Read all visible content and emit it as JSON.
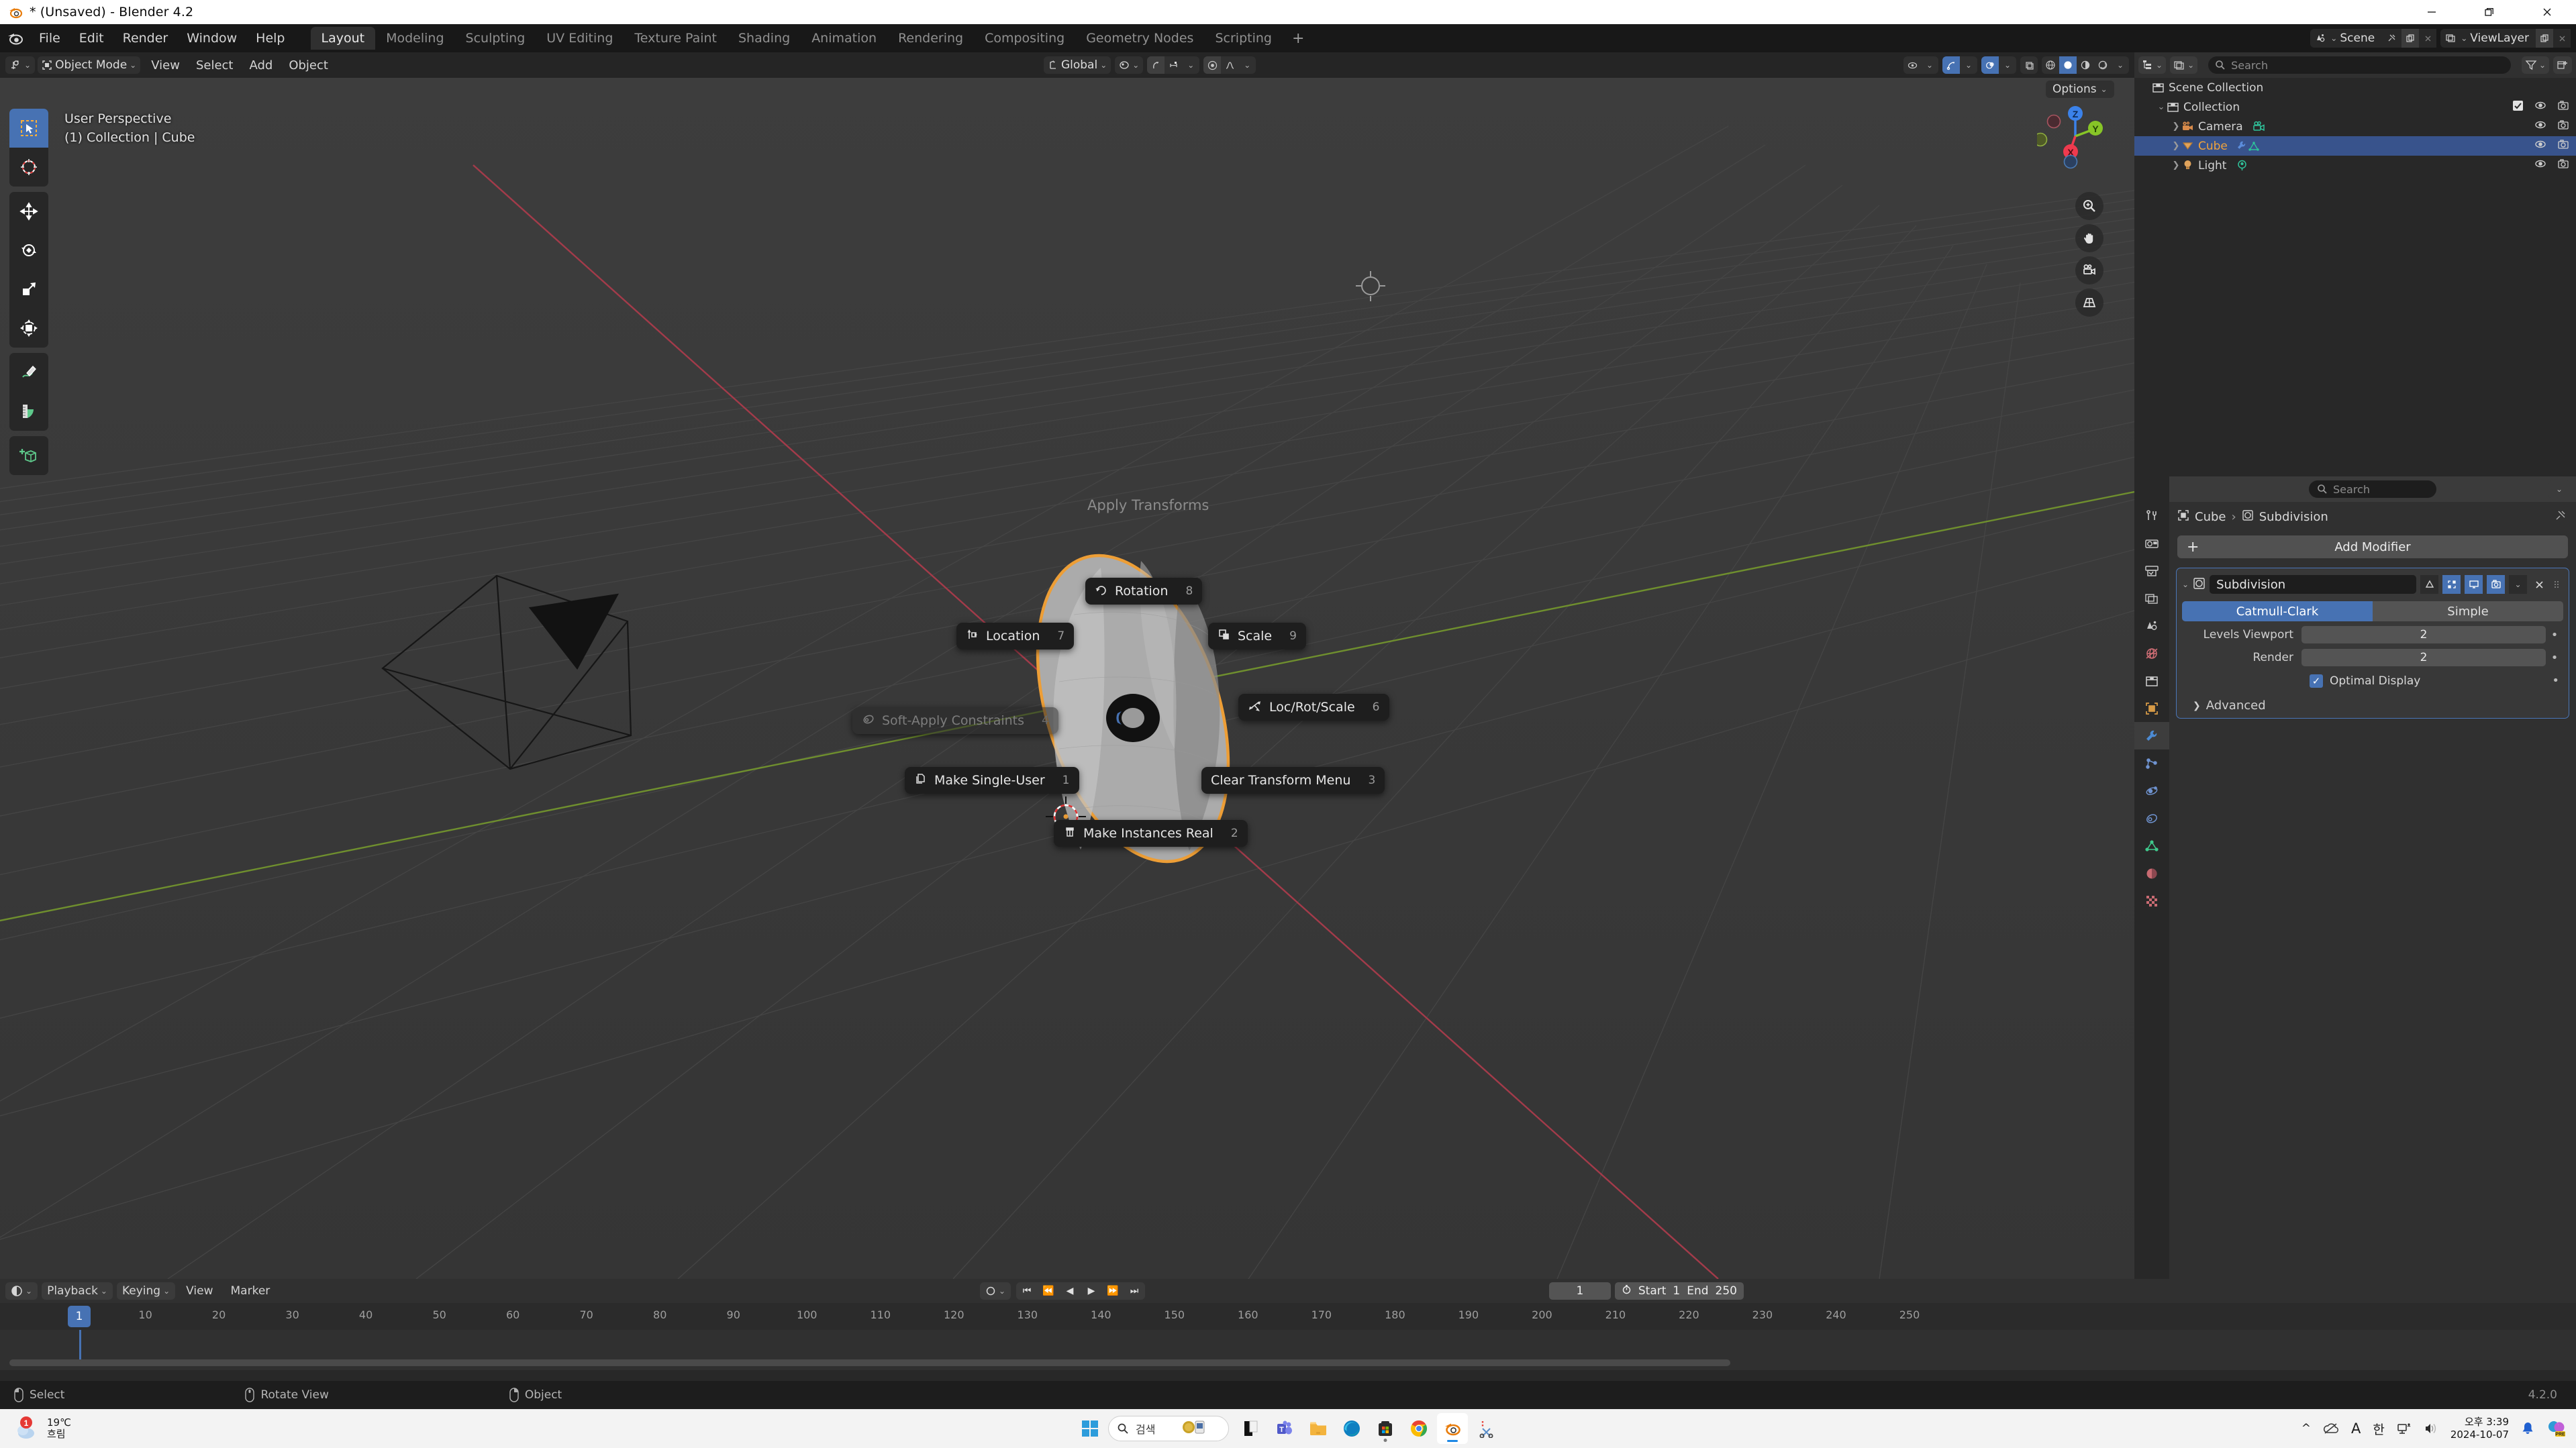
{
  "window": {
    "title": "* (Unsaved) - Blender 4.2",
    "minimize": "—",
    "restore": "❐",
    "close": "✕"
  },
  "topbar": {
    "menus": [
      "File",
      "Edit",
      "Render",
      "Window",
      "Help"
    ],
    "workspaces": [
      {
        "label": "Layout",
        "active": true
      },
      {
        "label": "Modeling",
        "active": false
      },
      {
        "label": "Sculpting",
        "active": false
      },
      {
        "label": "UV Editing",
        "active": false
      },
      {
        "label": "Texture Paint",
        "active": false
      },
      {
        "label": "Shading",
        "active": false
      },
      {
        "label": "Animation",
        "active": false
      },
      {
        "label": "Rendering",
        "active": false
      },
      {
        "label": "Compositing",
        "active": false
      },
      {
        "label": "Geometry Nodes",
        "active": false
      },
      {
        "label": "Scripting",
        "active": false
      }
    ],
    "add_workspace": "+",
    "scene_name": "Scene",
    "viewlayer_name": "ViewLayer"
  },
  "viewport_header": {
    "mode": "Object Mode",
    "menus": [
      "View",
      "Select",
      "Add",
      "Object"
    ],
    "transform_orientation": "Global",
    "options_label": "Options"
  },
  "viewport": {
    "perspective_label": "User Perspective",
    "collection_label": "(1) Collection | Cube",
    "gizmo_axes": [
      {
        "label": "Z",
        "color": "#3b82ea"
      },
      {
        "label": "Y",
        "color": "#87c527"
      },
      {
        "label": "X",
        "color": "#ef3a4e"
      }
    ],
    "tools": [
      "tweak-select-tool",
      "cursor-tool",
      "move-tool",
      "rotate-tool",
      "scale-tool",
      "transform-tool",
      "annotate-tool",
      "measure-tool",
      "add-cube-tool"
    ],
    "nav_buttons": [
      "zoom-icon",
      "pan-hand-icon",
      "camera-view-icon",
      "perspective-toggle-icon"
    ]
  },
  "pie_menu": {
    "title": "Apply Transforms",
    "items": [
      {
        "label": "Rotation",
        "shortcut": "8",
        "icon": "rotation-icon",
        "disabled": false
      },
      {
        "label": "Location",
        "shortcut": "7",
        "icon": "location-icon",
        "disabled": false
      },
      {
        "label": "Scale",
        "shortcut": "9",
        "icon": "scale-icon",
        "disabled": false
      },
      {
        "label": "Soft-Apply Constraints",
        "shortcut": "4",
        "icon": "constraints-icon",
        "disabled": true
      },
      {
        "label": "Loc/Rot/Scale",
        "shortcut": "6",
        "icon": "locrotscale-icon",
        "disabled": false
      },
      {
        "label": "Make Single-User",
        "shortcut": "1",
        "icon": "copy-icon",
        "disabled": false
      },
      {
        "label": "Clear Transform Menu",
        "shortcut": "3",
        "icon": "",
        "disabled": false
      },
      {
        "label": "Make Instances Real",
        "shortcut": "2",
        "icon": "instances-icon",
        "disabled": false
      }
    ]
  },
  "outliner": {
    "search_placeholder": "Search",
    "rows": [
      {
        "label": "Scene Collection",
        "indent": 0,
        "icon": "collection-icon",
        "selected": false,
        "expand": "",
        "has_vis": false
      },
      {
        "label": "Collection",
        "indent": 1,
        "icon": "collection-icon",
        "selected": false,
        "expand": "v",
        "has_vis": true,
        "has_check": true
      },
      {
        "label": "Camera",
        "indent": 2,
        "icon": "camera-icon",
        "selected": false,
        "expand": ">",
        "has_vis": true,
        "extra": "camera-data-icon"
      },
      {
        "label": "Cube",
        "indent": 2,
        "icon": "mesh-icon",
        "selected": true,
        "expand": ">",
        "has_vis": true,
        "extra": "modifier-icon"
      },
      {
        "label": "Light",
        "indent": 2,
        "icon": "light-icon",
        "selected": false,
        "expand": ">",
        "has_vis": true,
        "extra": "light-data-icon"
      }
    ]
  },
  "properties": {
    "search_placeholder": "Search",
    "breadcrumb": [
      "Cube",
      "Subdivision"
    ],
    "add_modifier_label": "Add Modifier",
    "modifier": {
      "name": "Subdivision",
      "type_options": [
        "Catmull-Clark",
        "Simple"
      ],
      "type_selected": "Catmull-Clark",
      "fields": [
        {
          "label": "Levels Viewport",
          "value": "2"
        },
        {
          "label": "Render",
          "value": "2"
        }
      ],
      "optimal_display_label": "Optimal Display",
      "optimal_display_checked": true,
      "advanced_label": "Advanced"
    },
    "tabs": [
      "tool-icon",
      "render-icon",
      "output-icon",
      "viewlayer-icon",
      "scene-icon",
      "world-icon",
      "collection-props-icon",
      "object-icon",
      "modifier-icon",
      "particles-icon",
      "physics-icon",
      "constraints-icon",
      "data-icon",
      "material-icon",
      "texture-icon"
    ],
    "active_tab": "modifier-icon"
  },
  "timeline": {
    "menus": [
      "Playback",
      "Keying",
      "View",
      "Marker"
    ],
    "current_frame": "1",
    "start_label": "Start",
    "start_value": "1",
    "end_label": "End",
    "end_value": "250",
    "playhead_frame": "1",
    "ticks": [
      10,
      20,
      30,
      40,
      50,
      60,
      70,
      80,
      90,
      100,
      110,
      120,
      130,
      140,
      150,
      160,
      170,
      180,
      190,
      200,
      210,
      220,
      230,
      240,
      250
    ]
  },
  "statusbar": {
    "items": [
      "Select",
      "Rotate View",
      "Object"
    ],
    "version": "4.2.0"
  },
  "taskbar": {
    "weather_temp": "19℃",
    "weather_desc": "흐림",
    "search_placeholder": "검색",
    "apps": [
      "windows-start-icon",
      "search-box",
      "news-icon",
      "copilot-app-icon",
      "teams-icon",
      "file-explorer-icon",
      "edge-icon",
      "store-icon",
      "chrome-icon",
      "blender-icon",
      "snipping-tool-icon"
    ],
    "tray": {
      "overflow": "^",
      "onedrive": "onedrive-icon",
      "ime_a": "A",
      "ime_ko": "한",
      "network": "network-icon",
      "volume": "volume-icon",
      "time": "오후 3:39",
      "date": "2024-10-07",
      "notifications": "bell-icon",
      "copilot": "copilot-icon"
    }
  },
  "colors": {
    "accent_blue": "#4772b3",
    "select_orange": "#ed9e36",
    "outliner_select": "#38538c",
    "axis_x": "#a33b4a",
    "axis_y": "#7a9b31"
  }
}
